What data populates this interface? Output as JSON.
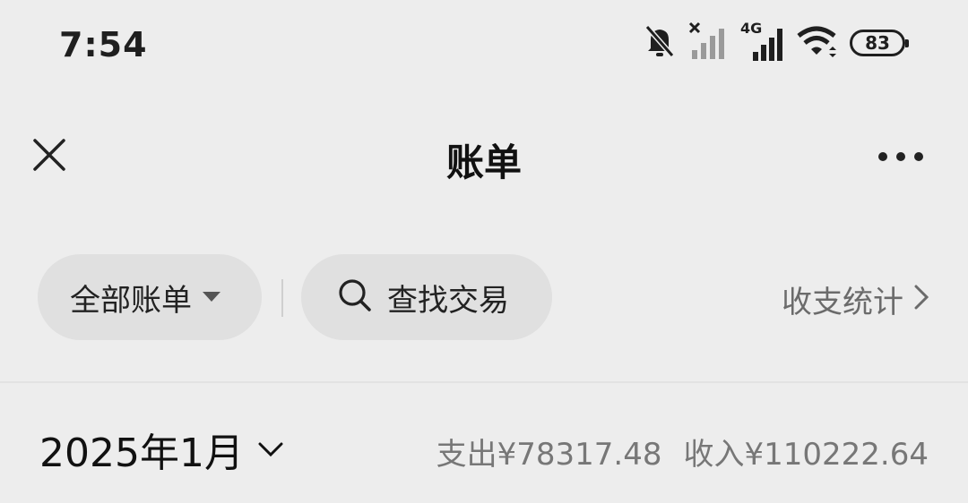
{
  "status_bar": {
    "time": "7:54",
    "battery": "83",
    "network_label": "4G",
    "icons": [
      "bell-off-icon",
      "signal-no-service-icon",
      "signal-4g-icon",
      "wifi-icon",
      "battery-icon"
    ]
  },
  "nav": {
    "title": "账单",
    "close_icon": "close-icon",
    "more_icon": "more-dots-icon"
  },
  "filters": {
    "all_bills_label": "全部账单",
    "search_label": "查找交易",
    "stats_label": "收支统计"
  },
  "month": {
    "label": "2025年1月",
    "expense_label": "支出",
    "expense_value": "¥78317.48",
    "income_label": "收入",
    "income_value": "¥110222.64"
  }
}
